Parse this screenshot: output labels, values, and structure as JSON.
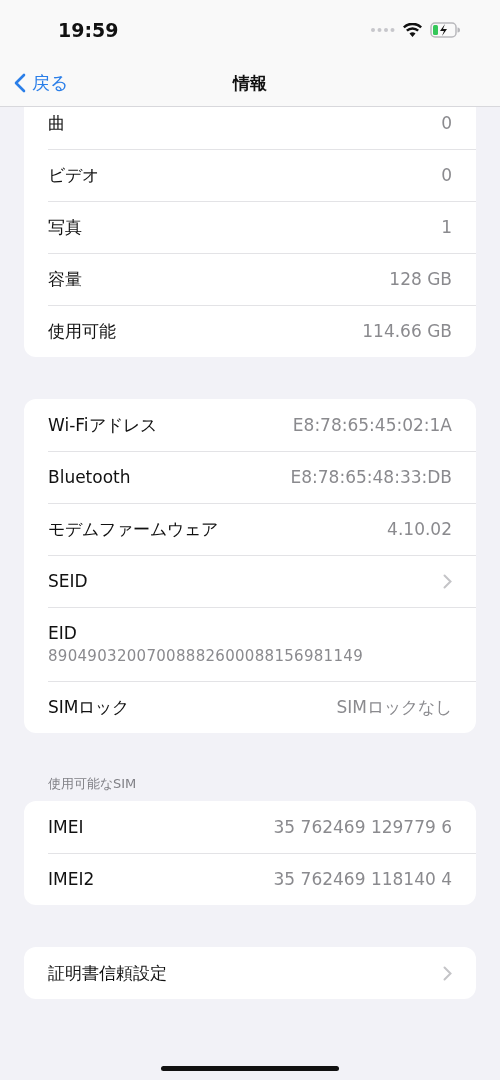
{
  "status_bar": {
    "time": "19:59"
  },
  "nav": {
    "back": "戻る",
    "title": "情報"
  },
  "groups": [
    {
      "rows": [
        {
          "kind": "value",
          "label": "曲",
          "value": "0"
        },
        {
          "kind": "value",
          "label": "ビデオ",
          "value": "0"
        },
        {
          "kind": "value",
          "label": "写真",
          "value": "1"
        },
        {
          "kind": "value",
          "label": "容量",
          "value": "128 GB"
        },
        {
          "kind": "value",
          "label": "使用可能",
          "value": "114.66 GB"
        }
      ]
    },
    {
      "rows": [
        {
          "kind": "value",
          "label": "Wi-Fiアドレス",
          "value": "E8:78:65:45:02:1A"
        },
        {
          "kind": "value",
          "label": "Bluetooth",
          "value": "E8:78:65:48:33:DB"
        },
        {
          "kind": "value",
          "label": "モデムファームウェア",
          "value": "4.10.02"
        },
        {
          "kind": "chevron",
          "label": "SEID"
        },
        {
          "kind": "stacked",
          "label": "EID",
          "value": "89049032007008882600088156981149"
        },
        {
          "kind": "value",
          "label": "SIMロック",
          "value": "SIMロックなし"
        }
      ]
    },
    {
      "header": "使用可能なSIM",
      "rows": [
        {
          "kind": "value",
          "label": "IMEI",
          "value": "35 762469 129779 6"
        },
        {
          "kind": "value",
          "label": "IMEI2",
          "value": "35 762469 118140 4"
        }
      ]
    },
    {
      "rows": [
        {
          "kind": "chevron",
          "label": "証明書信頼設定"
        }
      ]
    }
  ]
}
